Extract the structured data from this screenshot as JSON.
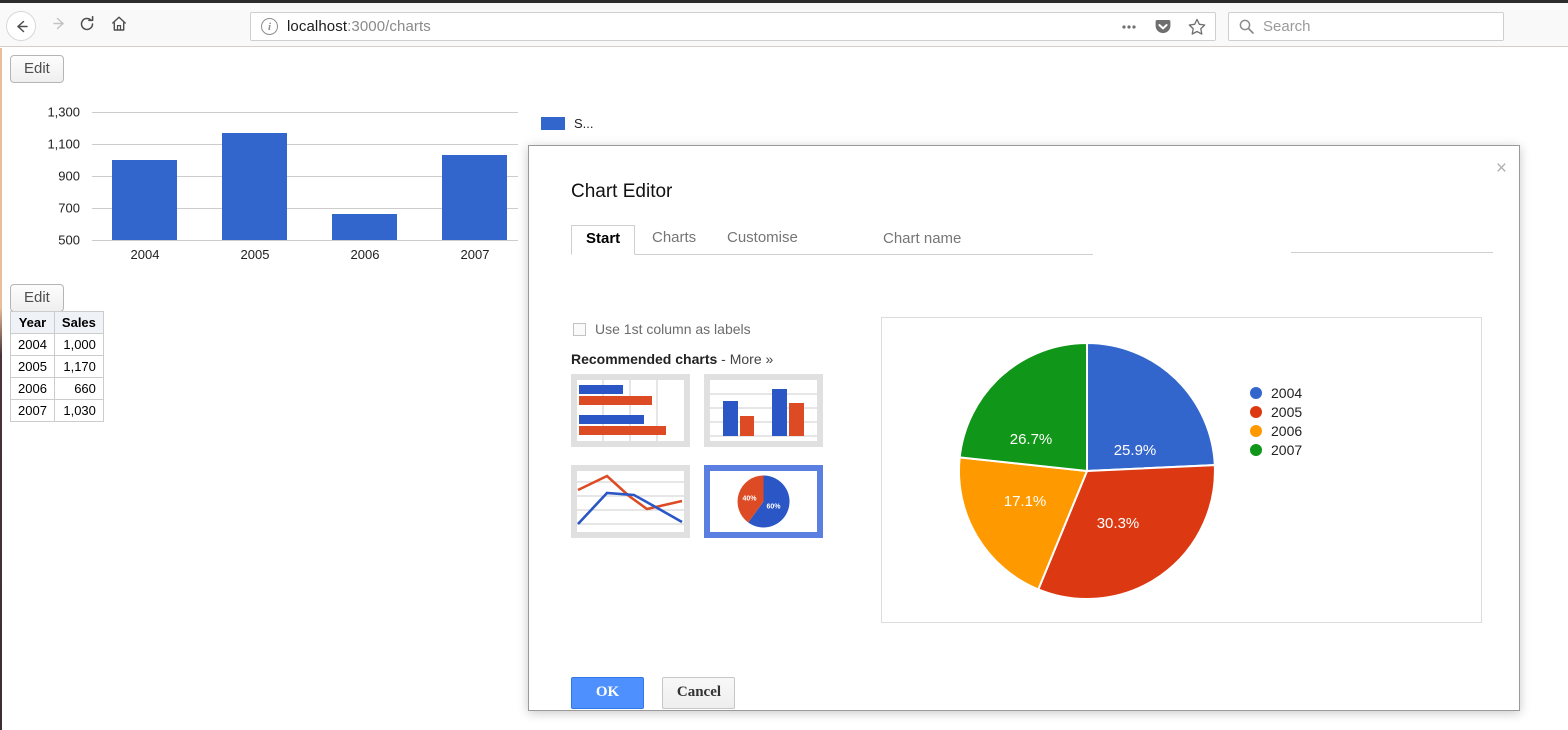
{
  "browser": {
    "back_icon": "arrow-left-icon",
    "forward_icon": "arrow-right-icon",
    "reload_icon": "reload-icon",
    "home_icon": "home-icon",
    "identity_icon": "info-icon",
    "identity_glyph": "i",
    "url_host": "localhost",
    "url_rest": ":3000/charts",
    "page_actions_icon": "ellipsis-icon",
    "pocket_icon": "pocket-icon",
    "bookmark_icon": "star-icon",
    "search_icon": "search-icon",
    "search_placeholder": "Search",
    "search_value": ""
  },
  "page": {
    "edit_button_chart": "Edit",
    "edit_button_table": "Edit",
    "bar_legend_label": "S...",
    "table": {
      "headers": [
        "Year",
        "Sales"
      ],
      "rows": [
        [
          "2004",
          "1,000"
        ],
        [
          "2005",
          "1,170"
        ],
        [
          "2006",
          "660"
        ],
        [
          "2007",
          "1,030"
        ]
      ]
    }
  },
  "dialog": {
    "title": "Chart Editor",
    "close_label": "×",
    "tabs": [
      {
        "label": "Start",
        "active": true
      },
      {
        "label": "Charts",
        "active": false
      },
      {
        "label": "Customise",
        "active": false
      }
    ],
    "chart_name_label": "Chart name",
    "chart_name_value": "",
    "chart_name_placeholder": "",
    "use_first_column_label": "Use 1st column as labels",
    "use_first_column_checked": false,
    "recommended_title": "Recommended charts",
    "recommended_separator": " - ",
    "recommended_more": "More »",
    "thumbnails": [
      {
        "name": "horizontal-bar-chart",
        "selected": false
      },
      {
        "name": "column-chart",
        "selected": false
      },
      {
        "name": "line-chart",
        "selected": false
      },
      {
        "name": "pie-chart",
        "selected": true
      }
    ],
    "thumbnail_pie_labels": [
      "40%",
      "60%"
    ],
    "ok_label": "OK",
    "cancel_label": "Cancel"
  },
  "colors": {
    "series_2004": "#3366cc",
    "series_2005": "#dc3912",
    "series_2006": "#ff9900",
    "series_2007": "#109618",
    "thumb_blue": "#2a56c6",
    "thumb_red": "#dd4b25",
    "ok_button": "#4d90fe",
    "selected_border": "#5b7fe0"
  },
  "chart_data": [
    {
      "id": "bar-chart",
      "type": "bar",
      "title": "",
      "xlabel": "",
      "ylabel": "",
      "categories": [
        "2004",
        "2005",
        "2006",
        "2007"
      ],
      "series": [
        {
          "name": "Sales",
          "values": [
            1000,
            1170,
            660,
            1030
          ],
          "color": "#3366cc"
        }
      ],
      "ylim": [
        500,
        1300
      ],
      "yticks": [
        500,
        700,
        900,
        1100,
        1300
      ],
      "ytick_labels": [
        "500",
        "700",
        "900",
        "1,100",
        "1,300"
      ],
      "grid": true,
      "legend": "right",
      "legend_entries": [
        "S..."
      ]
    },
    {
      "id": "preview-pie-chart",
      "type": "pie",
      "title": "",
      "categories": [
        "2004",
        "2005",
        "2006",
        "2007"
      ],
      "values": [
        1000,
        1170,
        660,
        1030
      ],
      "percent_labels": [
        "25.9%",
        "30.3%",
        "17.1%",
        "26.7%"
      ],
      "colors": [
        "#3366cc",
        "#dc3912",
        "#ff9900",
        "#109618"
      ],
      "legend": "right",
      "legend_entries": [
        "2004",
        "2005",
        "2006",
        "2007"
      ]
    },
    {
      "id": "thumbnail-pie-chart",
      "type": "pie",
      "values": [
        40,
        60
      ],
      "percent_labels": [
        "40%",
        "60%"
      ],
      "colors": [
        "#dd4b25",
        "#2a56c6"
      ]
    }
  ]
}
